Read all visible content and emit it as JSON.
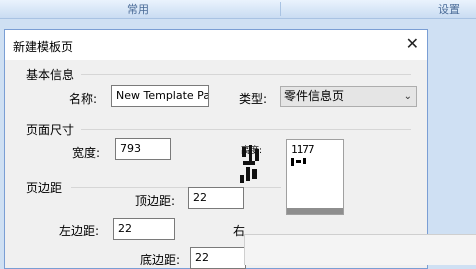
{
  "ribbon": {
    "tabs": [
      "常用",
      "设置"
    ]
  },
  "dialog": {
    "title": "新建模板页",
    "basic_info": {
      "group_title": "基本信息",
      "name_label": "名称:",
      "name_value": "New Template Page",
      "type_label": "类型:",
      "type_value": "零件信息页"
    },
    "page_size": {
      "group_title": "页面尺寸",
      "width_label": "宽度:",
      "width_value": "793",
      "height_label": "高度:",
      "preview_digits": "1177"
    },
    "margins": {
      "group_title": "页边距",
      "top_label": "顶边距:",
      "top_value": "22",
      "left_label": "左边距:",
      "left_value": "22",
      "right_label": "右",
      "bottom_label": "底边距:",
      "bottom_value": "22"
    }
  },
  "icons": {
    "close": "close-icon",
    "dropdown": "chevron-down-icon"
  }
}
